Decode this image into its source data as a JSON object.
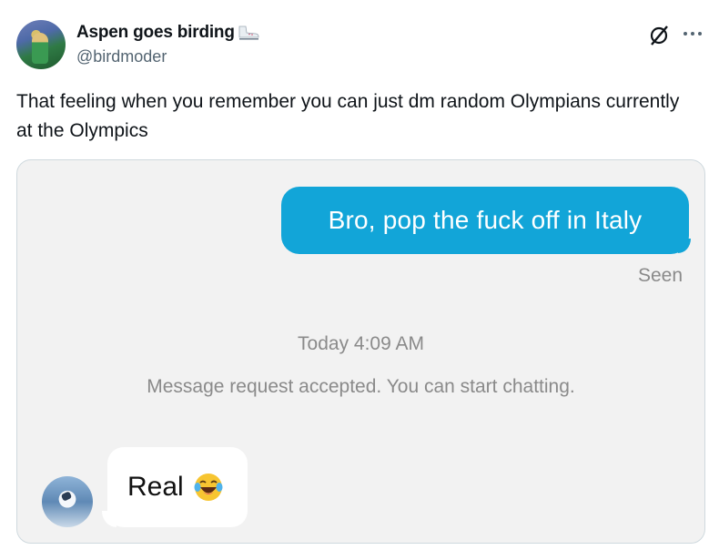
{
  "author": {
    "display_name": "Aspen goes birding",
    "handle": "@birdmoder",
    "name_emoji": "ice-skate-icon"
  },
  "tweet": {
    "text": "That feeling when you remember you can just dm random Olympians currently at the Olympics"
  },
  "actions": {
    "grok_icon": "grok-icon",
    "more_icon": "more-icon"
  },
  "chat": {
    "sent_message": "Bro, pop the fuck off in Italy",
    "seen_label": "Seen",
    "timestamp": "Today 4:09 AM",
    "system_message": "Message request accepted. You can start chatting.",
    "received_message": "Real",
    "received_emoji": "face-with-tears-of-joy-icon"
  },
  "colors": {
    "sent_bubble": "#12a5d8",
    "chat_background": "#f2f2f2",
    "meta_text": "#8a8a8a",
    "handle_text": "#536471"
  }
}
